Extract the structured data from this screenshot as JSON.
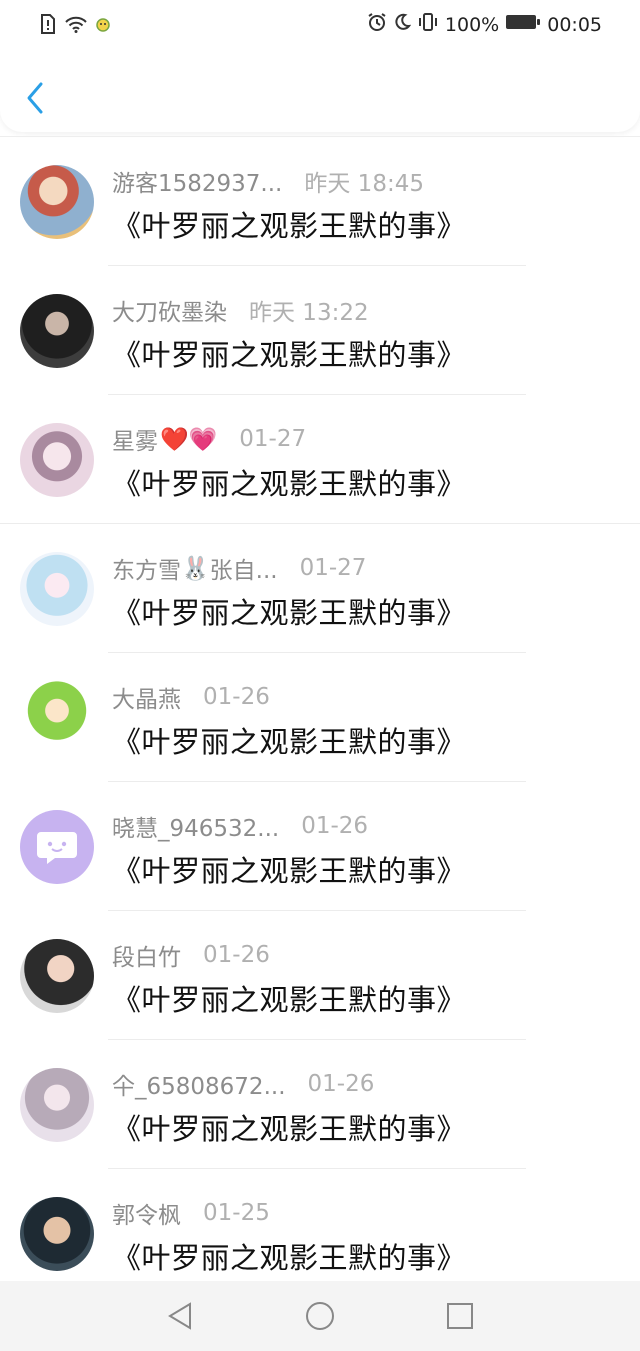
{
  "status_bar": {
    "battery_percent": "100%",
    "time": "00:05"
  },
  "colors": {
    "accent": "#2a9fe6",
    "name_gray": "#8c8c8c",
    "time_gray": "#b0b0b0"
  },
  "conversations": [
    {
      "name": "游客1582937...",
      "time": "昨天 18:45",
      "message": "《叶罗丽之观影王默的事》",
      "avatar_color": "#d88a6a"
    },
    {
      "name": "大刀砍墨染",
      "time": "昨天 13:22",
      "message": "《叶罗丽之观影王默的事》",
      "avatar_color": "#2e2e2e"
    },
    {
      "name": "星雾",
      "time": "01-27",
      "message": "《叶罗丽之观影王默的事》",
      "avatar_color": "#e6cbd8",
      "emoji": "❤️💗"
    },
    {
      "name": "东方雪",
      "name_suffix": "张自...",
      "time": "01-27",
      "message": "《叶罗丽之观影王默的事》",
      "avatar_color": "#cfe3f3",
      "emoji": "🐰"
    },
    {
      "name": "大晶燕",
      "time": "01-26",
      "message": "《叶罗丽之观影王默的事》",
      "avatar_color": "#b9e07a"
    },
    {
      "name": "晓慧_946532...",
      "time": "01-26",
      "message": "《叶罗丽之观影王默的事》",
      "avatar_color": "#c7b3f0"
    },
    {
      "name": "段白竹",
      "time": "01-26",
      "message": "《叶罗丽之观影王默的事》",
      "avatar_color": "#3a3a3a"
    },
    {
      "name": "仐_65808672...",
      "time": "01-26",
      "message": "《叶罗丽之观影王默的事》",
      "avatar_color": "#d9d2dc"
    },
    {
      "name": "郭令枫",
      "time": "01-25",
      "message": "《叶罗丽之观影王默的事》",
      "avatar_color": "#2b3a44"
    }
  ]
}
